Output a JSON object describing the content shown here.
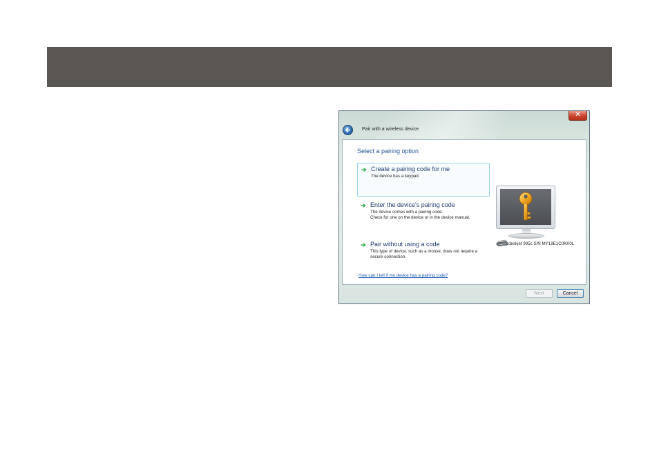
{
  "dialog": {
    "title": "Pair with a wireless device",
    "close_glyph": "✕",
    "heading": "Select a pairing option",
    "options": [
      {
        "title": "Create a pairing code for me",
        "desc": [
          "The device has a keypad."
        ]
      },
      {
        "title": "Enter the device's pairing code",
        "desc": [
          "The device comes with a pairing code.",
          "Check for one on the device or in the device manual."
        ]
      },
      {
        "title": "Pair without using a code",
        "desc": [
          "This type of device, such as a mouse, does not require a",
          "secure connection."
        ]
      }
    ],
    "help_link": "How can I tell if my device has a pairing code?",
    "device_label": "deskjet 995c S/N MY19E1C0KK0L",
    "next_label": "Next",
    "cancel_label": "Cancel",
    "icons": {
      "back": "back-arrow-icon",
      "option_arrow": "green-arrow-icon",
      "monitor": "monitor-key-icon",
      "printer": "printer-icon"
    }
  },
  "colors": {
    "header_bar": "#5a5753",
    "heading": "#1e4f93",
    "arrow": "#1fa845",
    "link": "#1a56b4"
  }
}
